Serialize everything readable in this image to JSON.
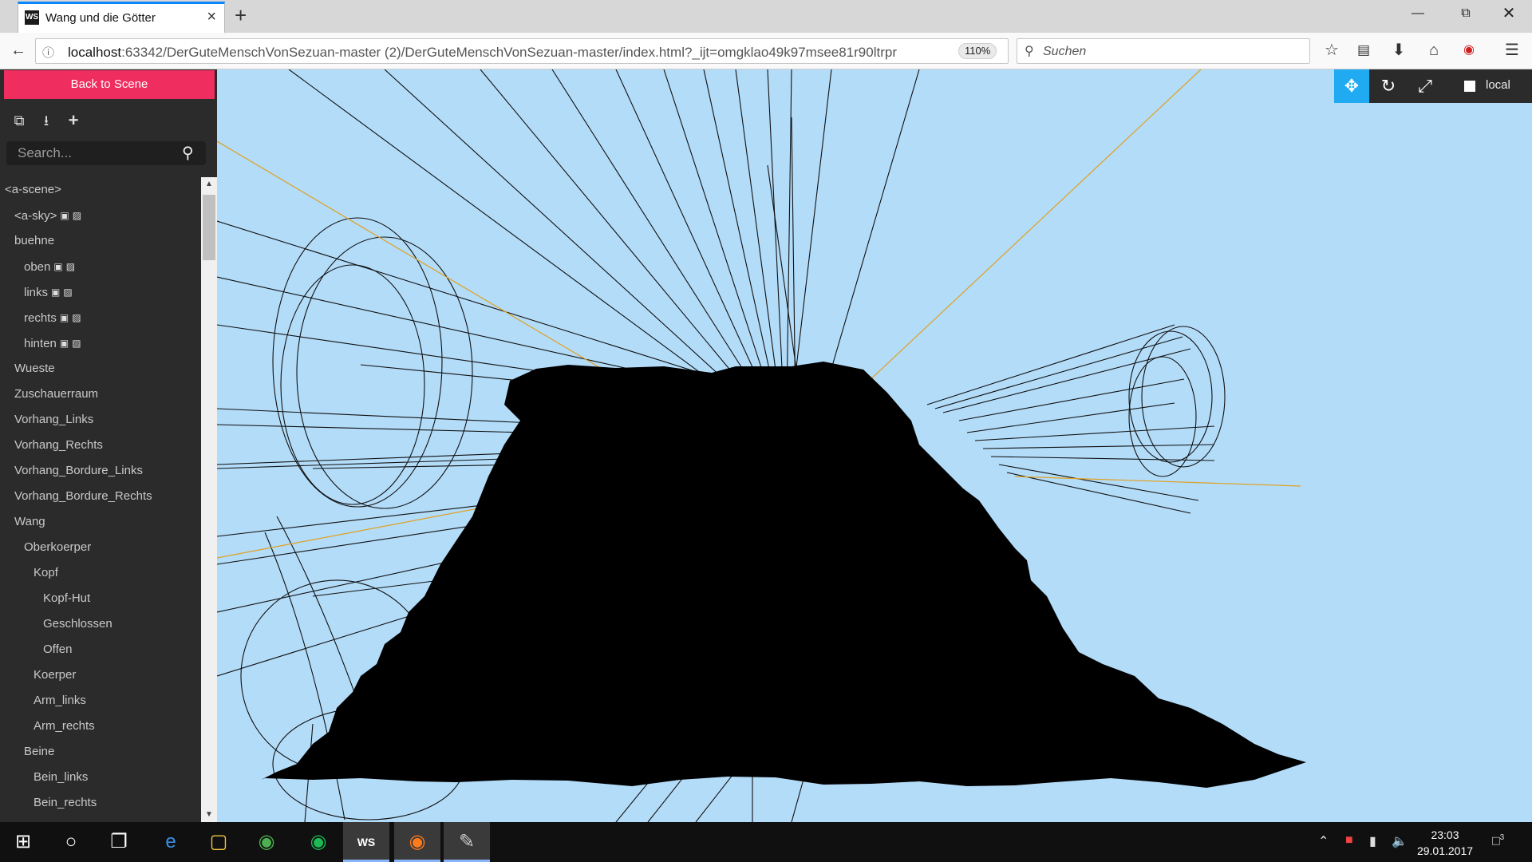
{
  "browser": {
    "tab_title": "Wang und die Götter",
    "tab_favicon": "WS",
    "url_host": "localhost",
    "url_rest": ":63342/DerGuteMenschVonSezuan-master (2)/DerGuteMenschVonSezuan-master/index.html?_ijt=omgklao49k97msee81r90ltrpr",
    "zoom": "110%",
    "search_placeholder": "Suchen"
  },
  "inspector": {
    "back_label": "Back to Scene",
    "search_placeholder": "Search...",
    "tree": [
      {
        "label": "<a-scene>",
        "depth": 0,
        "icons": false
      },
      {
        "label": "<a-sky>",
        "depth": 1,
        "icons": true
      },
      {
        "label": "buehne",
        "depth": 1,
        "icons": false
      },
      {
        "label": "oben",
        "depth": 2,
        "icons": true
      },
      {
        "label": "links",
        "depth": 2,
        "icons": true
      },
      {
        "label": "rechts",
        "depth": 2,
        "icons": true
      },
      {
        "label": "hinten",
        "depth": 2,
        "icons": true
      },
      {
        "label": "Wueste",
        "depth": 1,
        "icons": false
      },
      {
        "label": "Zuschauerraum",
        "depth": 1,
        "icons": false
      },
      {
        "label": "Vorhang_Links",
        "depth": 1,
        "icons": false
      },
      {
        "label": "Vorhang_Rechts",
        "depth": 1,
        "icons": false
      },
      {
        "label": "Vorhang_Bordure_Links",
        "depth": 1,
        "icons": false
      },
      {
        "label": "Vorhang_Bordure_Rechts",
        "depth": 1,
        "icons": false
      },
      {
        "label": "Wang",
        "depth": 1,
        "icons": false
      },
      {
        "label": "Oberkoerper",
        "depth": 2,
        "icons": false
      },
      {
        "label": "Kopf",
        "depth": 3,
        "icons": false
      },
      {
        "label": "Kopf-Hut",
        "depth": 4,
        "icons": false
      },
      {
        "label": "Geschlossen",
        "depth": 4,
        "icons": false
      },
      {
        "label": "Offen",
        "depth": 4,
        "icons": false
      },
      {
        "label": "Koerper",
        "depth": 3,
        "icons": false
      },
      {
        "label": "Arm_links",
        "depth": 3,
        "icons": false
      },
      {
        "label": "Arm_rechts",
        "depth": 3,
        "icons": false
      },
      {
        "label": "Beine",
        "depth": 2,
        "icons": false
      },
      {
        "label": "Bein_links",
        "depth": 3,
        "icons": false
      },
      {
        "label": "Bein_rechts",
        "depth": 3,
        "icons": false
      }
    ]
  },
  "viewport": {
    "local_label": "local",
    "colors": {
      "sky": "#b3dcf9",
      "toolbar_active": "#1faaf1",
      "helper": "#e0a020"
    }
  },
  "taskbar": {
    "time": "23:03",
    "date": "29.01.2017",
    "notification_count": "3"
  }
}
